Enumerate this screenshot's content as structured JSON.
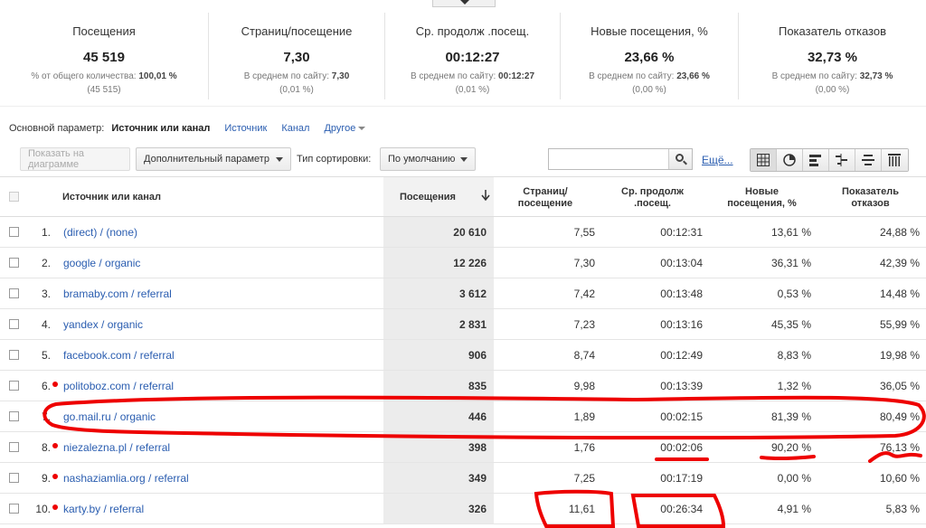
{
  "scorecards": [
    {
      "title": "Посещения",
      "value": "45 519",
      "sub_prefix": "% от общего количества: ",
      "sub_bold": "100,01 %",
      "sub2": "(45 515)"
    },
    {
      "title": "Страниц/посещение",
      "value": "7,30",
      "sub_prefix": "В среднем по сайту: ",
      "sub_bold": "7,30",
      "sub2": "(0,01 %)"
    },
    {
      "title": "Ср. продолж .посещ.",
      "value": "00:12:27",
      "sub_prefix": "В среднем по сайту: ",
      "sub_bold": "00:12:27",
      "sub2": "(0,01 %)"
    },
    {
      "title": "Новые посещения, %",
      "value": "23,66 %",
      "sub_prefix": "В среднем по сайту: ",
      "sub_bold": "23,66 %",
      "sub2": "(0,00 %)"
    },
    {
      "title": "Показатель отказов",
      "value": "32,73 %",
      "sub_prefix": "В среднем по сайту: ",
      "sub_bold": "32,73 %",
      "sub2": "(0,00 %)"
    }
  ],
  "dimension": {
    "label": "Основной параметр:",
    "active": "Источник или канал",
    "link1": "Источник",
    "link2": "Канал",
    "more": "Другое"
  },
  "toolbar": {
    "plot_button": "Показать на диаграмме",
    "secondary_dim": "Дополнительный параметр",
    "sort_label": "Тип сортировки:",
    "sort_value": "По умолчанию",
    "search_value": "",
    "more_link": "Ещё..."
  },
  "table": {
    "headers": {
      "source": "Источник или канал",
      "visits": "Посещения",
      "pages_1": "Страниц/",
      "pages_2": "посещение",
      "duration_1": "Ср. продолж",
      "duration_2": ".посещ.",
      "new_1": "Новые",
      "new_2": "посещения, %",
      "bounce_1": "Показатель",
      "bounce_2": "отказов"
    },
    "rows": [
      {
        "num": "1.",
        "source": "(direct) / (none)",
        "visits": "20 610",
        "pages": "7,55",
        "duration": "00:12:31",
        "new": "13,61 %",
        "bounce": "24,88 %"
      },
      {
        "num": "2.",
        "source": "google / organic",
        "visits": "12 226",
        "pages": "7,30",
        "duration": "00:13:04",
        "new": "36,31 %",
        "bounce": "42,39 %"
      },
      {
        "num": "3.",
        "source": "bramaby.com / referral",
        "visits": "3 612",
        "pages": "7,42",
        "duration": "00:13:48",
        "new": "0,53 %",
        "bounce": "14,48 %"
      },
      {
        "num": "4.",
        "source": "yandex / organic",
        "visits": "2 831",
        "pages": "7,23",
        "duration": "00:13:16",
        "new": "45,35 %",
        "bounce": "55,99 %"
      },
      {
        "num": "5.",
        "source": "facebook.com / referral",
        "visits": "906",
        "pages": "8,74",
        "duration": "00:12:49",
        "new": "8,83 %",
        "bounce": "19,98 %"
      },
      {
        "num": "6.",
        "source": "politoboz.com / referral",
        "visits": "835",
        "pages": "9,98",
        "duration": "00:13:39",
        "new": "1,32 %",
        "bounce": "36,05 %"
      },
      {
        "num": "7.",
        "source": "go.mail.ru / organic",
        "visits": "446",
        "pages": "1,89",
        "duration": "00:02:15",
        "new": "81,39 %",
        "bounce": "80,49 %"
      },
      {
        "num": "8.",
        "source": "niezalezna.pl / referral",
        "visits": "398",
        "pages": "1,76",
        "duration": "00:02:06",
        "new": "90,20 %",
        "bounce": "76,13 %"
      },
      {
        "num": "9.",
        "source": "nashaziamlia.org / referral",
        "visits": "349",
        "pages": "7,25",
        "duration": "00:17:19",
        "new": "0,00 %",
        "bounce": "10,60 %"
      },
      {
        "num": "10.",
        "source": "karty.by / referral",
        "visits": "326",
        "pages": "11,61",
        "duration": "00:26:34",
        "new": "4,91 %",
        "bounce": "5,83 %"
      }
    ]
  },
  "colors": {
    "link": "#2a5db0",
    "annotation": "#e00000"
  }
}
